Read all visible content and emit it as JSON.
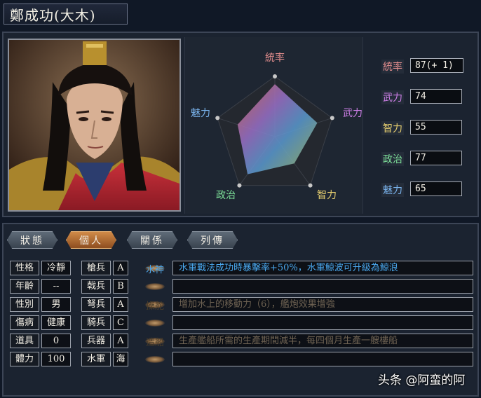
{
  "officer": {
    "name": "鄭成功(大木)"
  },
  "radar": {
    "labels": {
      "tong": "統率",
      "wu": "武力",
      "zhi": "智力",
      "zheng": "政治",
      "mei": "魅力"
    },
    "values": {
      "tong": 87,
      "wu": 74,
      "zhi": 55,
      "zheng": 77,
      "mei": 65
    },
    "max": 100
  },
  "stats": [
    {
      "label": "統率",
      "value": "87(+ 1)",
      "color": "#e89090"
    },
    {
      "label": "武力",
      "value": "74",
      "color": "#d080ea"
    },
    {
      "label": "智力",
      "value": "55",
      "color": "#e8d070"
    },
    {
      "label": "政治",
      "value": "77",
      "color": "#7ee29a"
    },
    {
      "label": "魅力",
      "value": "65",
      "color": "#7ab4ee"
    }
  ],
  "tabs": [
    {
      "label": "狀態",
      "active": false
    },
    {
      "label": "個人",
      "active": true
    },
    {
      "label": "關係",
      "active": false
    },
    {
      "label": "列傳",
      "active": false
    }
  ],
  "personal": [
    {
      "label": "性格",
      "value": "冷靜"
    },
    {
      "label": "年齡",
      "value": "--"
    },
    {
      "label": "性別",
      "value": "男"
    },
    {
      "label": "傷病",
      "value": "健康"
    },
    {
      "label": "道具",
      "value": "0"
    },
    {
      "label": "體力",
      "value": "100"
    }
  ],
  "aptitudes": [
    {
      "label": "槍兵",
      "rank": "A"
    },
    {
      "label": "戟兵",
      "rank": "B"
    },
    {
      "label": "弩兵",
      "rank": "A"
    },
    {
      "label": "騎兵",
      "rank": "C"
    },
    {
      "label": "兵器",
      "rank": "A"
    },
    {
      "label": "水軍",
      "rank": "海"
    }
  ],
  "skills": [
    {
      "name": "水神",
      "desc": "水軍戰法成功時暴擊率+50%，水軍鯨波可升級為鯨浪",
      "style": "blue"
    },
    {
      "name": "",
      "desc": "",
      "style": "empty"
    },
    {
      "name": "操舵",
      "desc": "增加水上的移動力（6），艦炮效果增強",
      "style": "dim"
    },
    {
      "name": "",
      "desc": "",
      "style": "empty"
    },
    {
      "name": "造船",
      "desc": "生產艦船所需的生產期間減半，每四個月生產一艘樓船",
      "style": "dim"
    },
    {
      "name": "",
      "desc": "",
      "style": "empty"
    }
  ],
  "watermark": "头条 @阿蛮的阿"
}
